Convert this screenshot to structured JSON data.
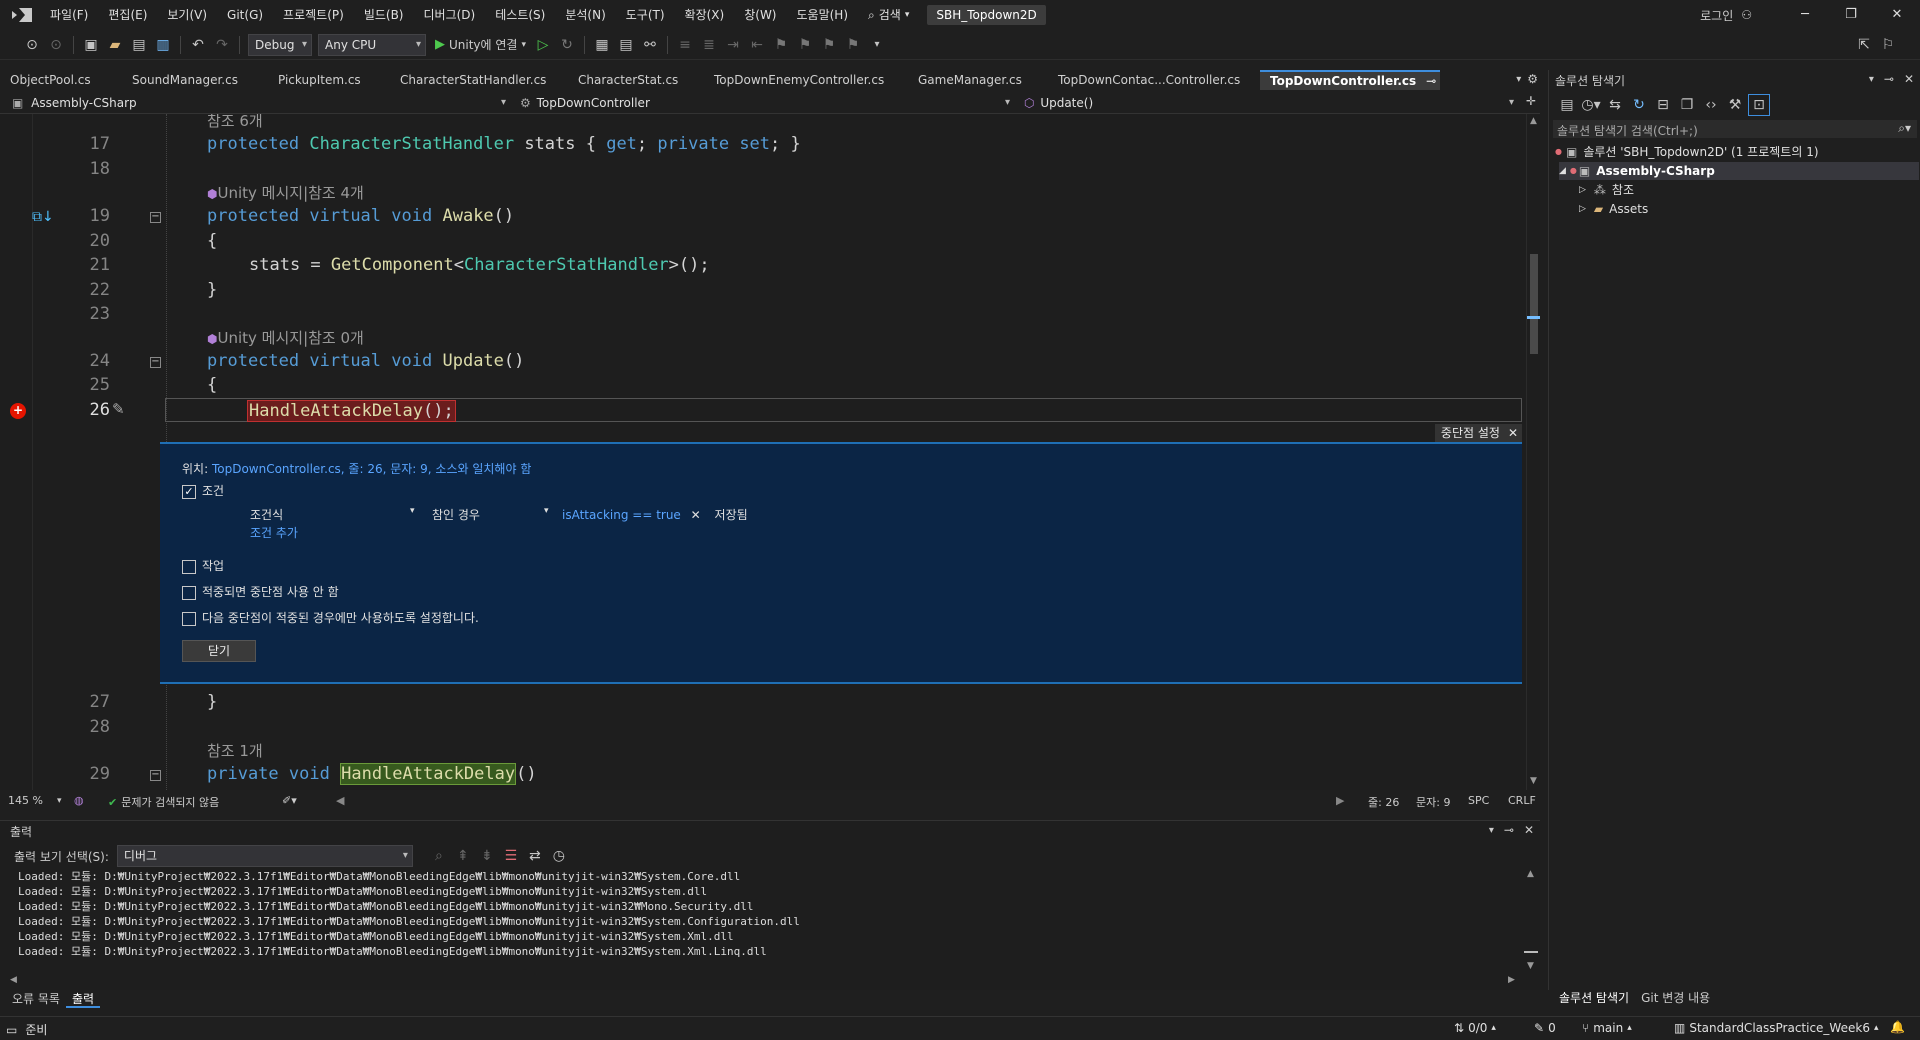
{
  "menubar": {
    "items": [
      "파일(F)",
      "편집(E)",
      "보기(V)",
      "Git(G)",
      "프로젝트(P)",
      "빌드(B)",
      "디버그(D)",
      "테스트(S)",
      "분석(N)",
      "도구(T)",
      "확장(X)",
      "창(W)",
      "도움말(H)"
    ],
    "search_label": "검색",
    "project_name": "SBH_Topdown2D",
    "login_label": "로그인"
  },
  "toolbar": {
    "configuration": "Debug",
    "platform": "Any CPU",
    "run_label": "Unity에 연결"
  },
  "doc_tabs": [
    "ObjectPool.cs",
    "SoundManager.cs",
    "PickupItem.cs",
    "CharacterStatHandler.cs",
    "CharacterStat.cs",
    "TopDownEnemyController.cs",
    "GameManager.cs",
    "TopDownContac...Controller.cs",
    "TopDownController.cs"
  ],
  "navbar": {
    "project": "Assembly-CSharp",
    "class": "TopDownController",
    "member": "Update()"
  },
  "editor": {
    "lines": [
      {
        "n": "",
        "lens": "참조 6개",
        "top_hint": "partial"
      },
      {
        "n": "17",
        "code": "protected CharacterStatHandler stats { get; private set; }"
      },
      {
        "n": "18",
        "code": ""
      },
      {
        "lens": "Unity 메시지|참조 4개"
      },
      {
        "n": "19",
        "code": "protected virtual void Awake()"
      },
      {
        "n": "20",
        "code": "{"
      },
      {
        "n": "21",
        "code": "stats = GetComponent<CharacterStatHandler>();"
      },
      {
        "n": "22",
        "code": "}"
      },
      {
        "n": "23",
        "code": ""
      },
      {
        "lens": "Unity 메시지|참조 0개"
      },
      {
        "n": "24",
        "code": "protected virtual void Update()"
      },
      {
        "n": "25",
        "code": "{"
      },
      {
        "n": "26",
        "code": "HandleAttackDelay();"
      },
      {
        "n": "27",
        "code": "}"
      },
      {
        "n": "28",
        "code": ""
      },
      {
        "lens": "참조 1개"
      },
      {
        "n": "29",
        "code": "private void HandleAttackDelay()"
      }
    ],
    "ln": {
      "l17": "17",
      "l18": "18",
      "l19": "19",
      "l20": "20",
      "l21": "21",
      "l22": "22",
      "l23": "23",
      "l24": "24",
      "l25": "25",
      "l26": "26",
      "l27": "27",
      "l28": "28",
      "l29": "29"
    },
    "lens_ref6": "참조 6개",
    "lens_awake": "Unity 메시지|참조 4개",
    "lens_update": "Unity 메시지|참조 0개",
    "lens_ref1": "참조 1개"
  },
  "breakpoint_settings": {
    "title": "중단점 설정",
    "location_prefix": "위치: ",
    "location_link": "TopDownController.cs, 줄: 26, 문자: 9, 소스와 일치해야 함",
    "conditions_label": "조건",
    "conditions_checked": true,
    "condition_type": "조건식",
    "condition_when": "참인 경우",
    "condition_expr": "isAttacking == true",
    "condition_status": "저장됨",
    "add_condition": "조건 추가",
    "actions_label": "작업",
    "disable_once_hit": "적중되면 중단점 사용 안 함",
    "only_enable_when": "다음 중단점이 적중된 경우에만 사용하도록 설정합니다.",
    "close_button": "닫기"
  },
  "editor_status": {
    "zoom": "145 %",
    "issues": "문제가 검색되지 않음",
    "line": "줄: 26",
    "col": "문자: 9",
    "spc": "SPC",
    "crlf": "CRLF"
  },
  "output_panel": {
    "title": "출력",
    "source_label": "출력 보기 선택(S):",
    "source_value": "디버그",
    "lines": [
      "Loaded: 모듈: D:₩UnityProject₩2022.3.17f1₩Editor₩Data₩MonoBleedingEdge₩lib₩mono₩unityjit-win32₩System.Core.dll",
      "Loaded: 모듈: D:₩UnityProject₩2022.3.17f1₩Editor₩Data₩MonoBleedingEdge₩lib₩mono₩unityjit-win32₩System.dll",
      "Loaded: 모듈: D:₩UnityProject₩2022.3.17f1₩Editor₩Data₩MonoBleedingEdge₩lib₩mono₩unityjit-win32₩Mono.Security.dll",
      "Loaded: 모듈: D:₩UnityProject₩2022.3.17f1₩Editor₩Data₩MonoBleedingEdge₩lib₩mono₩unityjit-win32₩System.Configuration.dll",
      "Loaded: 모듈: D:₩UnityProject₩2022.3.17f1₩Editor₩Data₩MonoBleedingEdge₩lib₩mono₩unityjit-win32₩System.Xml.dll",
      "Loaded: 모듈: D:₩UnityProject₩2022.3.17f1₩Editor₩Data₩MonoBleedingEdge₩lib₩mono₩unityjit-win32₩System.Xml.Linq.dll"
    ],
    "tab_errors": "오류 목록",
    "tab_output": "출력"
  },
  "solution_explorer": {
    "title": "솔루션 탐색기",
    "search_placeholder": "솔루션 탐색기 검색(Ctrl+;)",
    "solution_node": "솔루션 'SBH_Topdown2D' (1 프로젝트의 1)",
    "project_node": "Assembly-CSharp",
    "references_node": "참조",
    "assets_node": "Assets",
    "tab_solution": "솔루션 탐색기",
    "tab_git": "Git 변경 내용"
  },
  "statusbar": {
    "ready": "준비",
    "sync": "0/0",
    "edits": "0",
    "branch": "main",
    "repo": "StandardClassPractice_Week6"
  },
  "colors": {
    "accent": "#3e8ede",
    "breakpoint": "#e51400",
    "peek_bg": "#0b2545"
  }
}
